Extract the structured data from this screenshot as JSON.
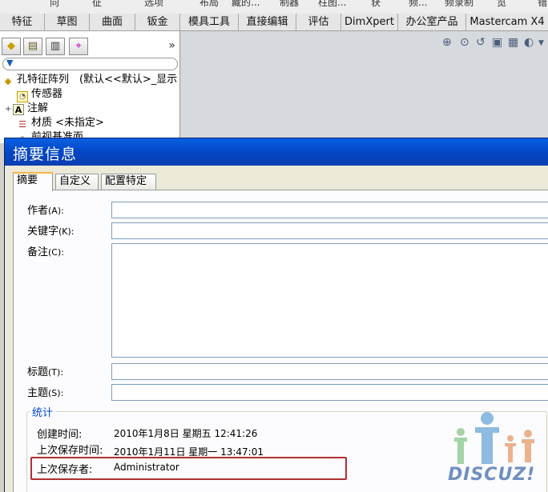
{
  "top_strip": [
    "向",
    "征",
    "选项",
    "布局",
    "藏的...",
    "制器",
    "柱图...",
    "获",
    "频...",
    "频录制",
    "览",
    "错"
  ],
  "ribbon_tabs": [
    "特征",
    "草图",
    "曲面",
    "钣金",
    "模具工具",
    "直接编辑",
    "评估",
    "DimXpert",
    "办公室产品",
    "Mastercam X4"
  ],
  "left_panel": {
    "more_glyph": "»",
    "tree": [
      {
        "label": "孔特征阵列　(默认<<默认>_显示",
        "icon": "part-icon"
      },
      {
        "label": "传感器",
        "icon": "sensor-icon"
      },
      {
        "label": "注解",
        "icon": "annotation-icon",
        "expander": "+"
      },
      {
        "label": "材质 <未指定>",
        "icon": "material-icon"
      },
      {
        "label": "前视基准面",
        "icon": "plane-icon"
      }
    ]
  },
  "dialog": {
    "title": "摘要信息",
    "tabs": [
      "摘要",
      "自定义",
      "配置特定"
    ],
    "fields": {
      "author": {
        "label": "作者",
        "key": "(A):"
      },
      "keywords": {
        "label": "关键字",
        "key": "(K):"
      },
      "comments": {
        "label": "备注",
        "key": "(C):"
      },
      "title": {
        "label": "标题",
        "key": "(T):"
      },
      "subject": {
        "label": "主题",
        "key": "(S):"
      }
    },
    "stats": {
      "legend": "统计",
      "created_label": "创建时间:",
      "created_value": "2010年1月8日 星期五 12:41:26",
      "saved_label": "上次保存时间:",
      "saved_value": "2010年1月11日 星期一 13:47:01",
      "savedby_label": "上次保存者:",
      "savedby_value": "Administrator"
    }
  },
  "watermark": {
    "text": "DISCUZ!"
  }
}
